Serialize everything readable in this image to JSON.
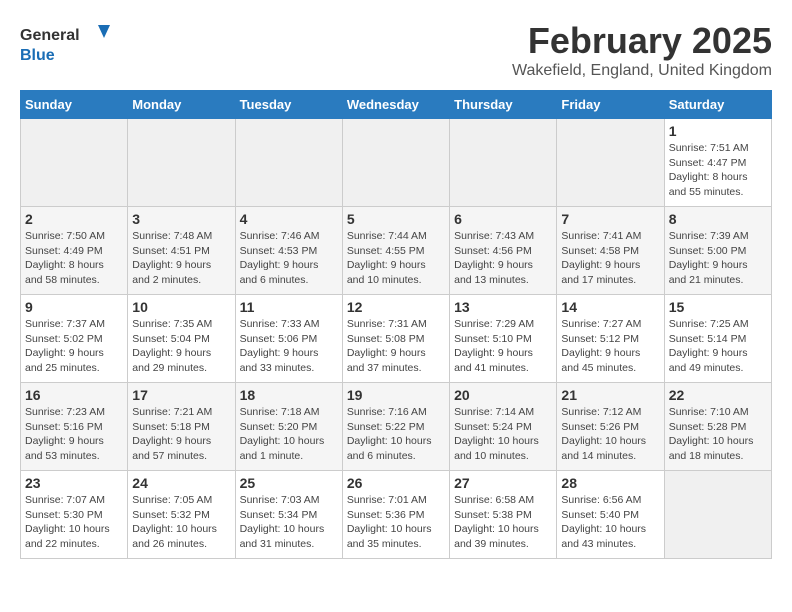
{
  "header": {
    "logo_line1": "General",
    "logo_line2": "Blue",
    "month": "February 2025",
    "location": "Wakefield, England, United Kingdom"
  },
  "weekdays": [
    "Sunday",
    "Monday",
    "Tuesday",
    "Wednesday",
    "Thursday",
    "Friday",
    "Saturday"
  ],
  "weeks": [
    [
      {
        "day": "",
        "info": ""
      },
      {
        "day": "",
        "info": ""
      },
      {
        "day": "",
        "info": ""
      },
      {
        "day": "",
        "info": ""
      },
      {
        "day": "",
        "info": ""
      },
      {
        "day": "",
        "info": ""
      },
      {
        "day": "1",
        "info": "Sunrise: 7:51 AM\nSunset: 4:47 PM\nDaylight: 8 hours and 55 minutes."
      }
    ],
    [
      {
        "day": "2",
        "info": "Sunrise: 7:50 AM\nSunset: 4:49 PM\nDaylight: 8 hours and 58 minutes."
      },
      {
        "day": "3",
        "info": "Sunrise: 7:48 AM\nSunset: 4:51 PM\nDaylight: 9 hours and 2 minutes."
      },
      {
        "day": "4",
        "info": "Sunrise: 7:46 AM\nSunset: 4:53 PM\nDaylight: 9 hours and 6 minutes."
      },
      {
        "day": "5",
        "info": "Sunrise: 7:44 AM\nSunset: 4:55 PM\nDaylight: 9 hours and 10 minutes."
      },
      {
        "day": "6",
        "info": "Sunrise: 7:43 AM\nSunset: 4:56 PM\nDaylight: 9 hours and 13 minutes."
      },
      {
        "day": "7",
        "info": "Sunrise: 7:41 AM\nSunset: 4:58 PM\nDaylight: 9 hours and 17 minutes."
      },
      {
        "day": "8",
        "info": "Sunrise: 7:39 AM\nSunset: 5:00 PM\nDaylight: 9 hours and 21 minutes."
      }
    ],
    [
      {
        "day": "9",
        "info": "Sunrise: 7:37 AM\nSunset: 5:02 PM\nDaylight: 9 hours and 25 minutes."
      },
      {
        "day": "10",
        "info": "Sunrise: 7:35 AM\nSunset: 5:04 PM\nDaylight: 9 hours and 29 minutes."
      },
      {
        "day": "11",
        "info": "Sunrise: 7:33 AM\nSunset: 5:06 PM\nDaylight: 9 hours and 33 minutes."
      },
      {
        "day": "12",
        "info": "Sunrise: 7:31 AM\nSunset: 5:08 PM\nDaylight: 9 hours and 37 minutes."
      },
      {
        "day": "13",
        "info": "Sunrise: 7:29 AM\nSunset: 5:10 PM\nDaylight: 9 hours and 41 minutes."
      },
      {
        "day": "14",
        "info": "Sunrise: 7:27 AM\nSunset: 5:12 PM\nDaylight: 9 hours and 45 minutes."
      },
      {
        "day": "15",
        "info": "Sunrise: 7:25 AM\nSunset: 5:14 PM\nDaylight: 9 hours and 49 minutes."
      }
    ],
    [
      {
        "day": "16",
        "info": "Sunrise: 7:23 AM\nSunset: 5:16 PM\nDaylight: 9 hours and 53 minutes."
      },
      {
        "day": "17",
        "info": "Sunrise: 7:21 AM\nSunset: 5:18 PM\nDaylight: 9 hours and 57 minutes."
      },
      {
        "day": "18",
        "info": "Sunrise: 7:18 AM\nSunset: 5:20 PM\nDaylight: 10 hours and 1 minute."
      },
      {
        "day": "19",
        "info": "Sunrise: 7:16 AM\nSunset: 5:22 PM\nDaylight: 10 hours and 6 minutes."
      },
      {
        "day": "20",
        "info": "Sunrise: 7:14 AM\nSunset: 5:24 PM\nDaylight: 10 hours and 10 minutes."
      },
      {
        "day": "21",
        "info": "Sunrise: 7:12 AM\nSunset: 5:26 PM\nDaylight: 10 hours and 14 minutes."
      },
      {
        "day": "22",
        "info": "Sunrise: 7:10 AM\nSunset: 5:28 PM\nDaylight: 10 hours and 18 minutes."
      }
    ],
    [
      {
        "day": "23",
        "info": "Sunrise: 7:07 AM\nSunset: 5:30 PM\nDaylight: 10 hours and 22 minutes."
      },
      {
        "day": "24",
        "info": "Sunrise: 7:05 AM\nSunset: 5:32 PM\nDaylight: 10 hours and 26 minutes."
      },
      {
        "day": "25",
        "info": "Sunrise: 7:03 AM\nSunset: 5:34 PM\nDaylight: 10 hours and 31 minutes."
      },
      {
        "day": "26",
        "info": "Sunrise: 7:01 AM\nSunset: 5:36 PM\nDaylight: 10 hours and 35 minutes."
      },
      {
        "day": "27",
        "info": "Sunrise: 6:58 AM\nSunset: 5:38 PM\nDaylight: 10 hours and 39 minutes."
      },
      {
        "day": "28",
        "info": "Sunrise: 6:56 AM\nSunset: 5:40 PM\nDaylight: 10 hours and 43 minutes."
      },
      {
        "day": "",
        "info": ""
      }
    ]
  ]
}
